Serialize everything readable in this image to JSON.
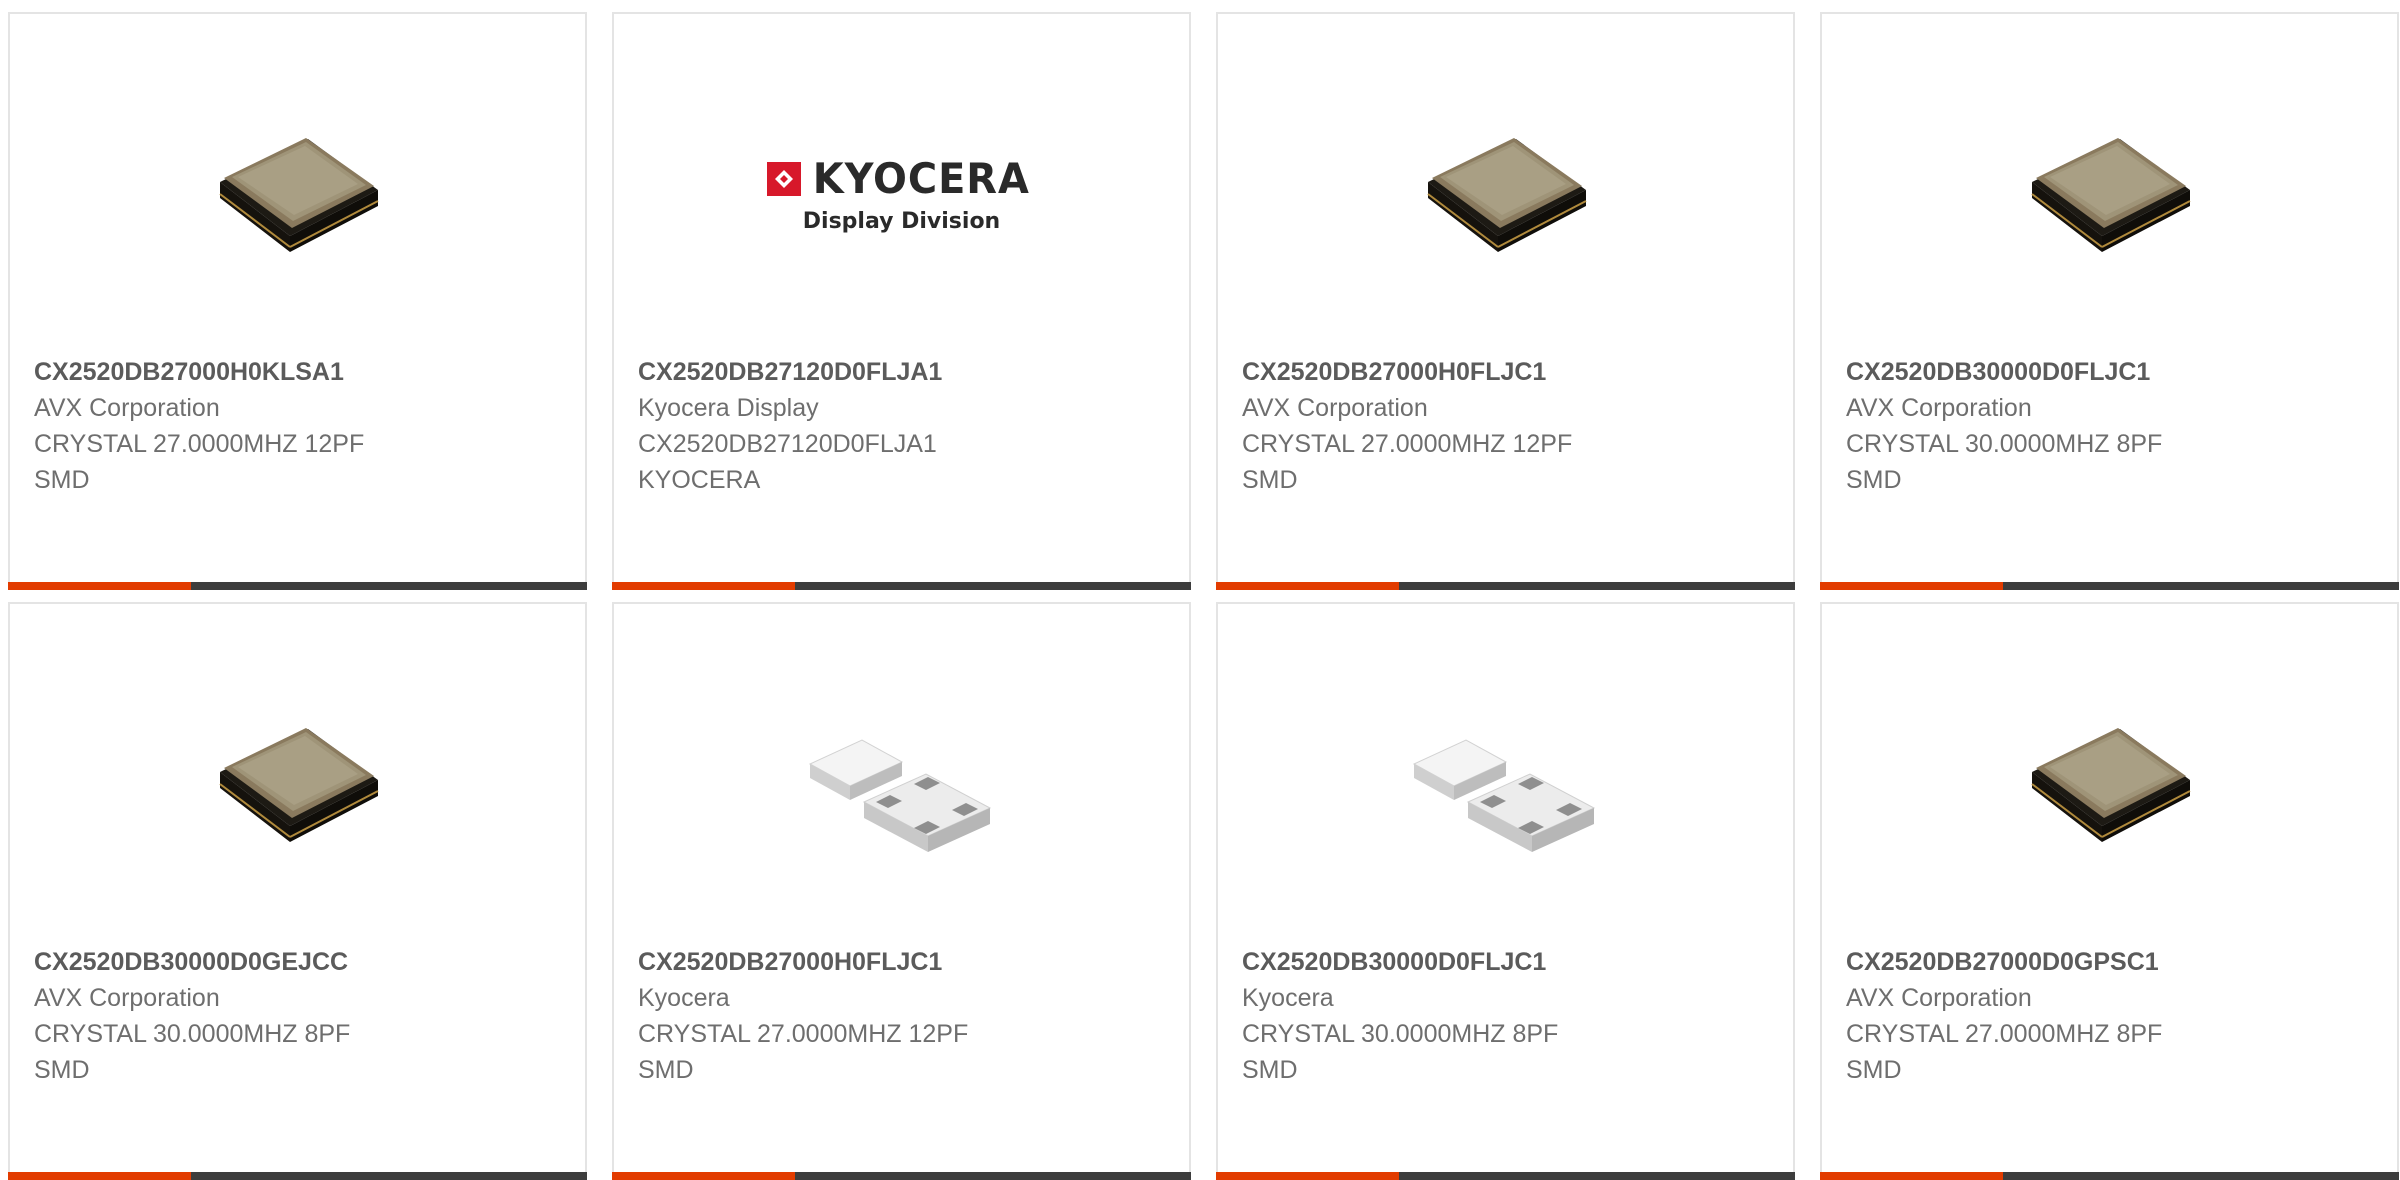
{
  "cards": [
    {
      "part_number": "CX2520DB27000H0KLSA1",
      "manufacturer": "AVX Corporation",
      "description": "CRYSTAL 27.0000MHZ 12PF",
      "package": "SMD",
      "image": "crystal-metal-icon"
    },
    {
      "part_number": "CX2520DB27120D0FLJA1",
      "manufacturer": "Kyocera Display",
      "description": "CX2520DB27120D0FLJA1",
      "package": "KYOCERA",
      "image": "kyocera-logo",
      "logo_word": "KYOCERA",
      "logo_sub": "Display Division"
    },
    {
      "part_number": "CX2520DB27000H0FLJC1",
      "manufacturer": "AVX Corporation",
      "description": "CRYSTAL 27.0000MHZ 12PF",
      "package": "SMD",
      "image": "crystal-metal-icon"
    },
    {
      "part_number": "CX2520DB30000D0FLJC1",
      "manufacturer": "AVX Corporation",
      "description": "CRYSTAL 30.0000MHZ 8PF",
      "package": "SMD",
      "image": "crystal-metal-icon"
    },
    {
      "part_number": "CX2520DB30000D0GEJCC",
      "manufacturer": "AVX Corporation",
      "description": "CRYSTAL 30.0000MHZ 8PF",
      "package": "SMD",
      "image": "crystal-metal-icon"
    },
    {
      "part_number": "CX2520DB27000H0FLJC1",
      "manufacturer": "Kyocera",
      "description": "CRYSTAL 27.0000MHZ 12PF",
      "package": "SMD",
      "image": "crystal-ceramic-icon"
    },
    {
      "part_number": "CX2520DB30000D0FLJC1",
      "manufacturer": "Kyocera",
      "description": "CRYSTAL 30.0000MHZ 8PF",
      "package": "SMD",
      "image": "crystal-ceramic-icon"
    },
    {
      "part_number": "CX2520DB27000D0GPSC1",
      "manufacturer": "AVX Corporation",
      "description": "CRYSTAL 27.0000MHZ 8PF",
      "package": "SMD",
      "image": "crystal-metal-icon"
    }
  ],
  "colors": {
    "accent": "#e23c00",
    "bar": "#3d3d3d",
    "card_border": "#e4e4e4",
    "part_number_text": "#5b5b5b",
    "detail_text": "#6e6e6e",
    "logo_red": "#d7182a"
  }
}
